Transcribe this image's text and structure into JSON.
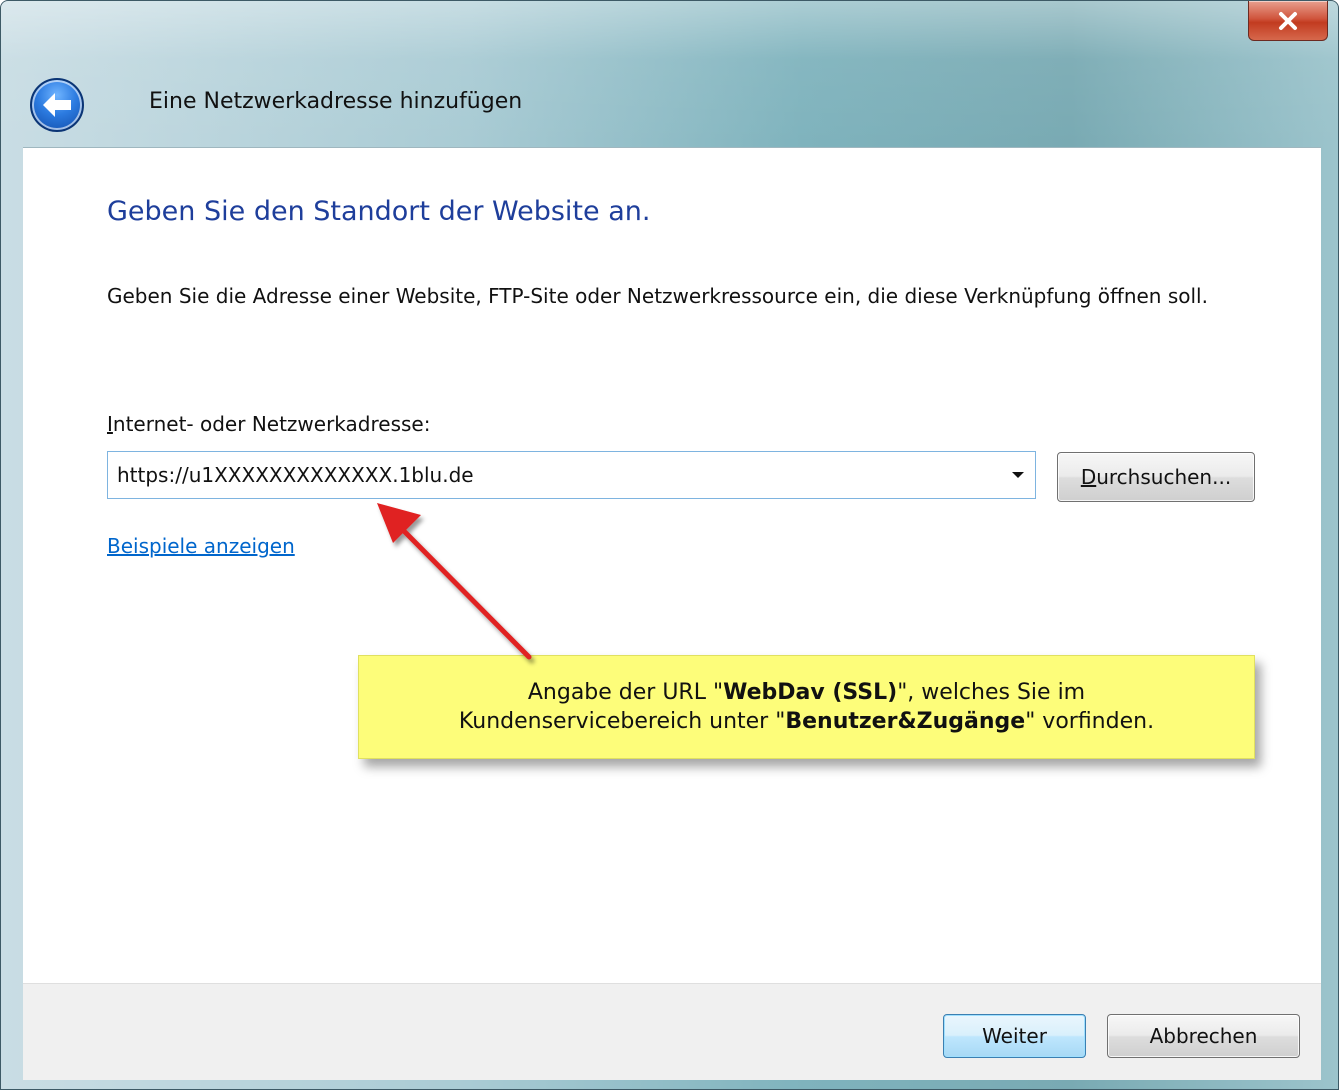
{
  "window": {
    "title": "Eine Netzwerkadresse hinzufügen",
    "close_label": "x"
  },
  "main": {
    "heading": "Geben Sie den Standort der Website an.",
    "description": "Geben Sie die Adresse einer Website, FTP-Site oder Netzwerkressource ein, die diese Verknüpfung öffnen soll.",
    "address_label_access_key": "I",
    "address_label_rest": "nternet- oder Netzwerkadresse:",
    "address_value": "https://u1XXXXXXXXXXXXX.1blu.de",
    "browse_access_key": "D",
    "browse_rest": "urchsuchen...",
    "examples_link": "Beispiele anzeigen"
  },
  "callout": {
    "line1_pre": "Angabe der URL \"",
    "line1_bold": "WebDav (SSL)",
    "line1_post": "\", welches Sie im",
    "line2_pre": "Kundenservicebereich unter \"",
    "line2_bold": "Benutzer&Zugänge",
    "line2_post": "\" vorfinden."
  },
  "footer": {
    "next_label": "Weiter",
    "cancel_label": "Abbrechen"
  },
  "colors": {
    "heading": "#1e3e9b",
    "link": "#0066cc",
    "callout_bg": "#fdfd7a",
    "arrow": "#e02020",
    "close_button": "#c23b20"
  },
  "icons": {
    "back": "back-arrow-icon",
    "close": "close-icon",
    "dropdown": "chevron-down-icon"
  }
}
